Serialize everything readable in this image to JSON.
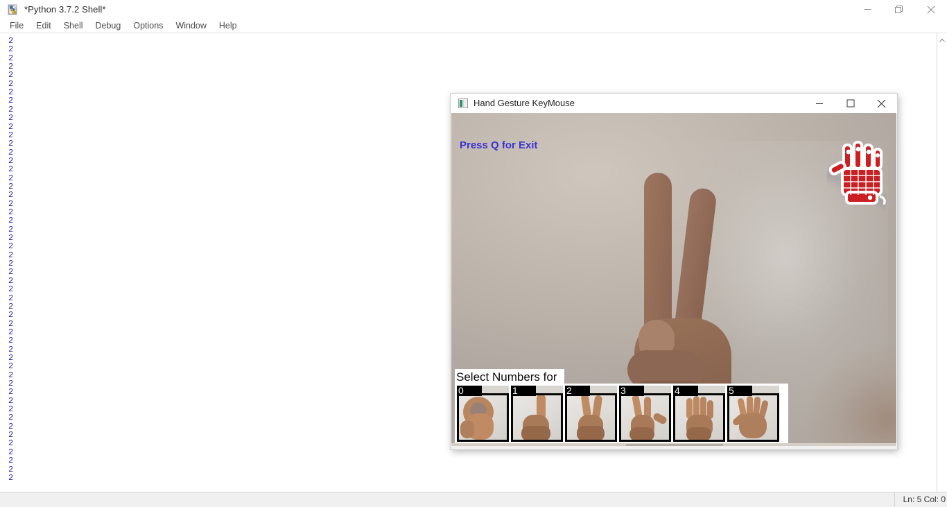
{
  "idle": {
    "title": "*Python 3.7.2 Shell*",
    "icon": "python-idle-icon",
    "menus": [
      "File",
      "Edit",
      "Shell",
      "Debug",
      "Options",
      "Window",
      "Help"
    ],
    "window_controls": {
      "minimize": "minimize-icon",
      "restore": "restore-icon",
      "close": "close-icon"
    },
    "output_value": "2",
    "output_line_count": 52,
    "output_color": "#2727a8",
    "status": "Ln: 5   Col: 0",
    "scrollbar": "vertical-scrollbar"
  },
  "cv_window": {
    "title": "Hand Gesture KeyMouse",
    "icon": "opencv-window-icon",
    "window_controls": {
      "minimize": "minimize-icon",
      "maximize": "maximize-icon",
      "close": "close-icon"
    },
    "overlay_text": "Press Q for Exit",
    "overlay_text_color": "#3a32cf",
    "logo": "robotic-glove-logo",
    "logo_color": "#cc1f22",
    "detected_gesture": "2",
    "selector_label": "Select Numbers for ",
    "thumbnails": [
      {
        "number": "0",
        "gesture": "fist-ok-zero"
      },
      {
        "number": "1",
        "gesture": "one-finger-up"
      },
      {
        "number": "2",
        "gesture": "two-fingers-peace"
      },
      {
        "number": "3",
        "gesture": "three-fingers"
      },
      {
        "number": "4",
        "gesture": "four-fingers"
      },
      {
        "number": "5",
        "gesture": "open-palm-five"
      }
    ]
  }
}
